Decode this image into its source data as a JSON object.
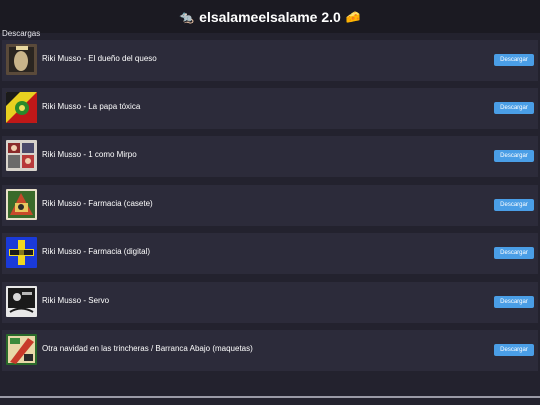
{
  "header": {
    "title": "elsalameelsalame 2.0",
    "left_icon": "rat-emoji",
    "right_icon": "cheese-emoji"
  },
  "section": {
    "label": "Descargas"
  },
  "downloads": [
    {
      "title": "Riki Musso - El dueño del queso",
      "button": "Descargar",
      "thumb_icon": "album-cover-duenio-del-queso"
    },
    {
      "title": "Riki Musso - La papa tóxica",
      "button": "Descargar",
      "thumb_icon": "album-cover-papa-toxica"
    },
    {
      "title": "Riki Musso - 1 como Mirpo",
      "button": "Descargar",
      "thumb_icon": "album-cover-1-como-mirpo"
    },
    {
      "title": "Riki Musso - Farmacia (casete)",
      "button": "Descargar",
      "thumb_icon": "album-cover-farmacia-casete"
    },
    {
      "title": "Riki Musso - Farmacia (digital)",
      "button": "Descargar",
      "thumb_icon": "album-cover-farmacia-digital"
    },
    {
      "title": "Riki Musso - Servo",
      "button": "Descargar",
      "thumb_icon": "album-cover-servo"
    },
    {
      "title": "Otra navidad en las trincheras / Barranca Abajo (maquetas)",
      "button": "Descargar",
      "thumb_icon": "album-cover-otra-navidad"
    }
  ],
  "colors": {
    "background": "#23222e",
    "header": "#1b1a22",
    "row": "#2c2b3a",
    "button": "#4a9ee6"
  }
}
